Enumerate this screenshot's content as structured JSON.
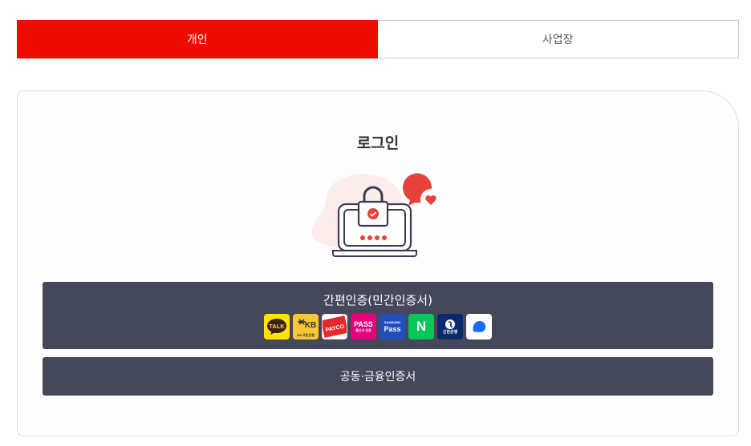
{
  "tabs": [
    {
      "label": "개인",
      "active": true
    },
    {
      "label": "사업장",
      "active": false
    }
  ],
  "login": {
    "title": "로그인",
    "simple_auth_label": "간편인증(민간인증서)",
    "public_cert_label": "공동·금융인증서"
  },
  "providers": [
    {
      "name": "kakao-talk",
      "text": "TALK",
      "bg": "#fee500",
      "fg": "#3c1e1e"
    },
    {
      "name": "kb",
      "text": "KB",
      "sub": "KB 국민은행",
      "bg": "#f7c736",
      "fg": "#333333"
    },
    {
      "name": "payco",
      "text": "PAYCO",
      "bg": "#ffffff",
      "fg": "#ffffff"
    },
    {
      "name": "pass",
      "text": "PASS",
      "sub": "통신사 인증",
      "bg": "#e6007e",
      "fg": "#ffffff"
    },
    {
      "name": "samsung-pass",
      "text": "Pass",
      "sub": "SAMSUNG",
      "bg": "#1f4fbf",
      "fg": "#ffffff"
    },
    {
      "name": "naver",
      "text": "N",
      "bg": "#03c75a",
      "fg": "#ffffff"
    },
    {
      "name": "shinhan",
      "text": "신한은행",
      "bg": "#0a2a6c",
      "fg": "#ffffff"
    },
    {
      "name": "toss",
      "text": "",
      "bg": "#ffffff",
      "fg": "#1a6cff"
    }
  ],
  "colors": {
    "accent": "#ee0b00",
    "button": "#45475b"
  }
}
